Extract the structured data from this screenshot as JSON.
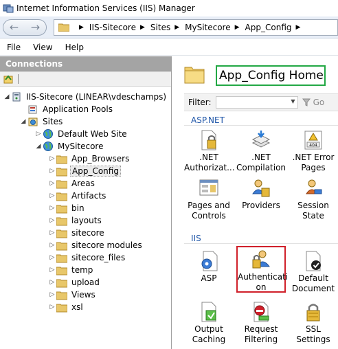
{
  "window": {
    "title": "Internet Information Services (IIS) Manager"
  },
  "address": {
    "crumbs": [
      "IIS-Sitecore",
      "Sites",
      "MySitecore",
      "App_Config"
    ]
  },
  "menu": {
    "items": [
      "File",
      "View",
      "Help"
    ]
  },
  "connections": {
    "header": "Connections",
    "tree": {
      "server": "IIS-Sitecore (LINEAR\\vdeschamps)",
      "app_pools": "Application Pools",
      "sites": "Sites",
      "default_site": "Default Web Site",
      "mysitecore": "MySitecore",
      "folders": [
        "App_Browsers",
        "App_Config",
        "Areas",
        "Artifacts",
        "bin",
        "layouts",
        "sitecore",
        "sitecore modules",
        "sitecore_files",
        "temp",
        "upload",
        "Views",
        "xsl"
      ]
    }
  },
  "main": {
    "home_title": "App_Config Home",
    "filter_label": "Filter:",
    "go_label": "Go",
    "groups": {
      "aspnet": "ASP.NET",
      "iis": "IIS"
    },
    "features": {
      "net_auth": ".NET Authorizat...",
      "net_comp": ".NET Compilation",
      "net_err": ".NET Error Pages",
      "pages_controls": "Pages and Controls",
      "providers": "Providers",
      "session_state": "Session State",
      "asp": "ASP",
      "authentication": "Authenticati on",
      "default_doc": "Default Document",
      "output_caching": "Output Caching",
      "request_filtering": "Request Filtering",
      "ssl_settings": "SSL Settings"
    },
    "error_icon_text": "404"
  },
  "colors": {
    "highlight_green": "#22a844",
    "highlight_red": "#d0202a",
    "group_blue": "#1f56a8"
  }
}
